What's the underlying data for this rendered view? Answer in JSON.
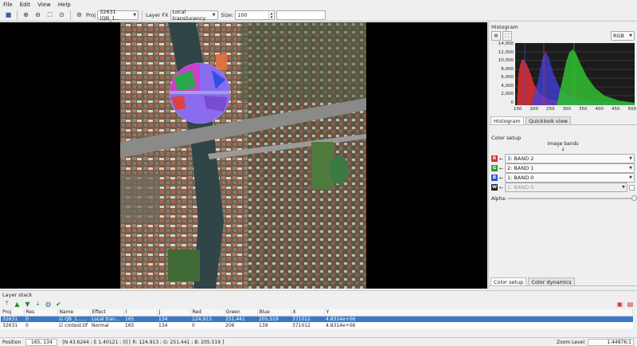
{
  "menu": [
    "File",
    "Edit",
    "View",
    "Help"
  ],
  "toolbar": {
    "proj_label": "Proj",
    "proj_value": "32631 (QB_1...",
    "layer_fx_label": "Layer FX",
    "layer_fx_value": "Local translucency",
    "size_label": "Size:",
    "size_value": "100",
    "extra_value": ""
  },
  "histogram": {
    "title": "Histogram",
    "mode": "RGB",
    "y_ticks": [
      "14,000",
      "12,000",
      "10,000",
      "8,000",
      "6,000",
      "4,000",
      "2,000",
      "0"
    ],
    "x_ticks": [
      "150",
      "200",
      "250",
      "300",
      "350",
      "400",
      "450",
      "500"
    ],
    "colors": {
      "red": "#e03030",
      "green": "#30c030",
      "blue": "#4040e0"
    },
    "tabs": [
      "Histogram",
      "Quicklook view"
    ]
  },
  "color_setup": {
    "title": "Color setup",
    "image_bands_label": "Image bands",
    "arrow": "↓",
    "bands": [
      {
        "channel": "R",
        "value": "3: BAND 2",
        "color": "#e03030",
        "enabled": true
      },
      {
        "channel": "G",
        "value": "2: BAND 1",
        "color": "#30a030",
        "enabled": true
      },
      {
        "channel": "B",
        "value": "1: BAND 0",
        "color": "#3050e0",
        "enabled": true
      },
      {
        "channel": "W",
        "value": "1: BAND 0",
        "color": "#222222",
        "enabled": false
      }
    ],
    "alpha_label": "Alpha:",
    "tabs": [
      "Color setup",
      "Color dynamics"
    ]
  },
  "layer_stack": {
    "title": "Layer stack",
    "columns": [
      "Proj",
      "Res",
      "Name",
      "Effect",
      "I",
      "J",
      "Red",
      "Green",
      "Blue",
      "X",
      "Y"
    ],
    "rows": [
      {
        "proj": "32631",
        "res": "0",
        "name": "QB_1...s...",
        "effect": "Local transl...",
        "i": "165",
        "j": "134",
        "red": "124,913",
        "green": "251,441",
        "blue": "205,519",
        "x": "371012",
        "y": "4.8314e+06",
        "selected": true
      },
      {
        "proj": "32631",
        "res": "0",
        "name": "cmtest.tif",
        "effect": "Normal",
        "i": "165",
        "j": "134",
        "red": "0",
        "green": "206",
        "blue": "139",
        "x": "371012",
        "y": "4.8314e+06",
        "selected": false
      }
    ]
  },
  "status": {
    "position_label": "Position",
    "position_value": "165, 134",
    "info": "[N 43.6244 ; E 1.40121 ; 0] [ R: 124.913 ; G: 251.441 ; B: 205.519 ]",
    "zoom_label": "Zoom Level",
    "zoom_value": "1.44876:1"
  }
}
